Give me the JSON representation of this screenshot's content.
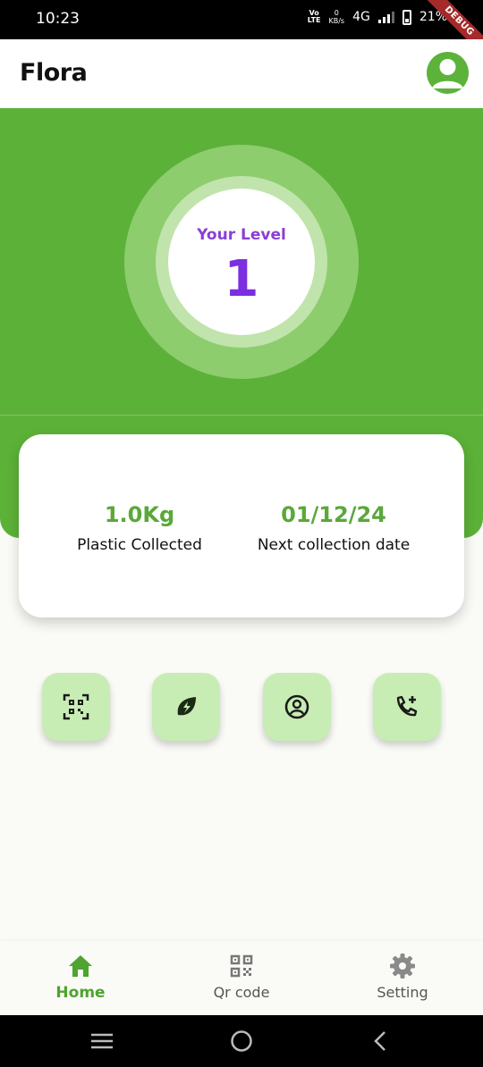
{
  "status_bar": {
    "time": "10:23",
    "volte": "Vo\nLTE",
    "speed_value": "0",
    "speed_unit": "KB/s",
    "network": "4G",
    "battery": "21%",
    "debug_banner": "DEBUG"
  },
  "app_bar": {
    "title": "Flora",
    "avatar_icon": "account-circle-icon"
  },
  "level": {
    "label": "Your Level",
    "value": "1"
  },
  "stats": {
    "plastic_value": "1.0Kg",
    "plastic_label": "Plastic Collected",
    "date_value": "01/12/24",
    "date_label": "Next collection date"
  },
  "actions": [
    {
      "icon": "qr-scan-icon"
    },
    {
      "icon": "eco-leaf-icon"
    },
    {
      "icon": "account-circle-icon"
    },
    {
      "icon": "add-call-icon"
    }
  ],
  "bottom_nav": {
    "items": [
      {
        "label": "Home",
        "icon": "home-icon",
        "active": true
      },
      {
        "label": "Qr code",
        "icon": "qr-code-icon",
        "active": false
      },
      {
        "label": "Setting",
        "icon": "settings-gear-icon",
        "active": false
      }
    ]
  },
  "colors": {
    "primary_green": "#5cb138",
    "action_button_bg": "#c8edb4",
    "level_purple": "#7b2fe0",
    "stat_green": "#5aa83a"
  }
}
